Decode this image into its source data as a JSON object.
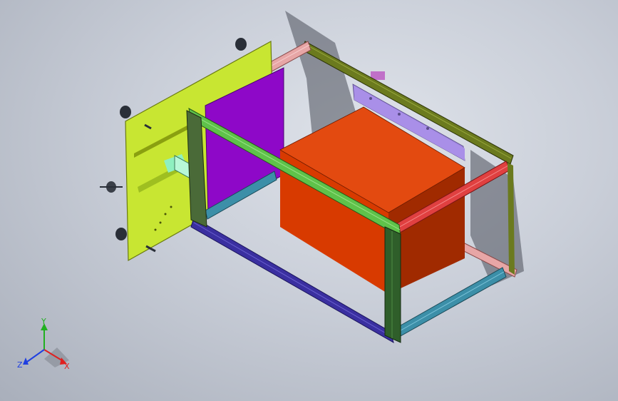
{
  "viewport": {
    "background_top": "#dfe3ea",
    "background_bottom": "#a9afbb"
  },
  "model": {
    "parts": [
      {
        "name": "mounting-plate",
        "color": "#c8e632"
      },
      {
        "name": "purple-panel",
        "color": "#8e08c8"
      },
      {
        "name": "orange-box",
        "color": "#e03a00"
      },
      {
        "name": "lavender-plate",
        "color": "#a98fe8"
      },
      {
        "name": "green-rail",
        "color": "#5fc24a"
      },
      {
        "name": "red-rail",
        "color": "#e04040"
      },
      {
        "name": "pink-rail",
        "color": "#e7a6a6"
      },
      {
        "name": "olive-rail",
        "color": "#6b7a1e"
      },
      {
        "name": "navy-rail",
        "color": "#3a2fa0"
      },
      {
        "name": "teal-rail",
        "color": "#3c8fa8"
      },
      {
        "name": "dark-green-post",
        "color": "#2f5e2a"
      },
      {
        "name": "mint-bracket",
        "color": "#8ef0c0"
      },
      {
        "name": "suction-cup",
        "color": "#2a2f38"
      }
    ]
  },
  "triad": {
    "x_label": "X",
    "y_label": "Y",
    "z_label": "Z",
    "x_color": "#e02020",
    "y_color": "#20b020",
    "z_color": "#2040e0"
  }
}
